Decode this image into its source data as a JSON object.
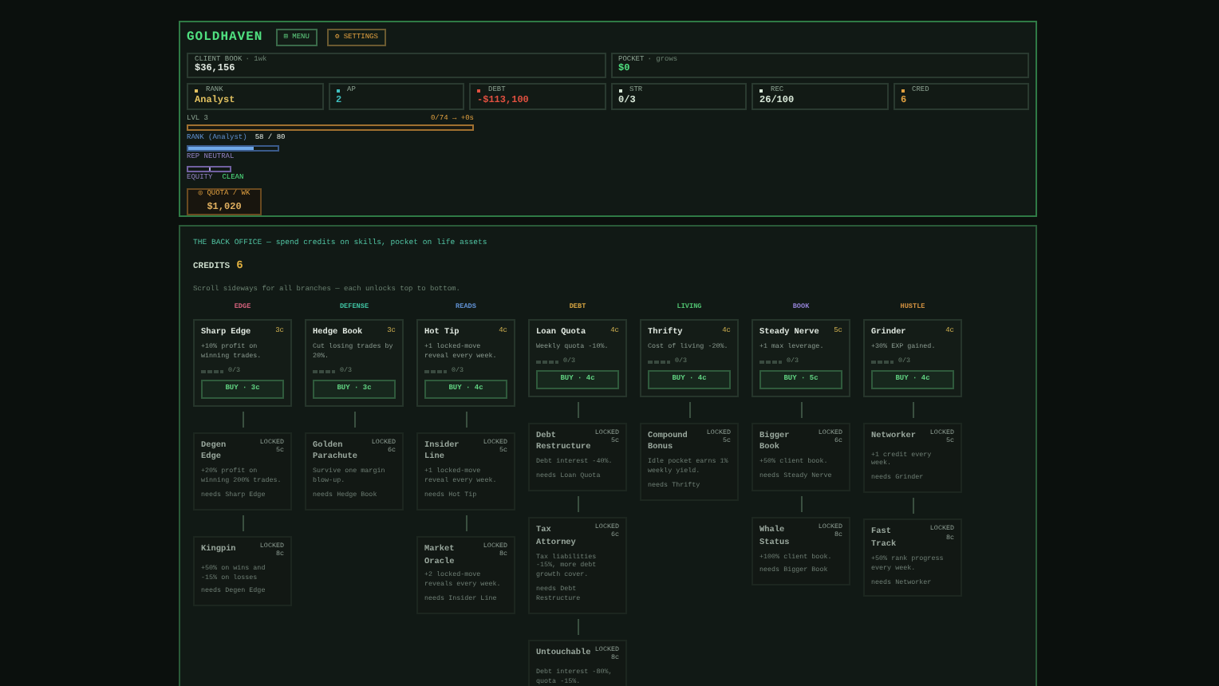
{
  "header": {
    "logo": "GOLDHAVEN",
    "buttons": [
      {
        "icon": "⊞",
        "label": "MENU",
        "kind": "menu"
      },
      {
        "icon": "⚙",
        "label": "SETTINGS",
        "kind": "settings"
      }
    ]
  },
  "wallets": [
    {
      "label": "CLIENT BOOK",
      "note": "· 1wk",
      "value": "$36,156",
      "kind": "book"
    },
    {
      "label": "POCKET",
      "note": "· grows",
      "value": "$0",
      "kind": "pocket"
    }
  ],
  "stats": [
    {
      "label": "RANK",
      "value": "Analyst",
      "color": "#e0c060"
    },
    {
      "label": "AP",
      "value": "2",
      "color": "#40c0c0"
    },
    {
      "label": "DEBT",
      "value": "-$113,100",
      "color": "#e05040"
    },
    {
      "label": "STR",
      "value": "0/3",
      "color": "#d8e8d8"
    },
    {
      "label": "REC",
      "value": "26/100",
      "color": "#d8e8d8"
    },
    {
      "label": "CRED",
      "value": "6",
      "color": "#e0a040"
    }
  ],
  "level": {
    "label": "LVL 3",
    "reading": "0/74 → +0s",
    "level": 0
  },
  "rank": {
    "label": "RANK (Analyst)",
    "reading": "58 / 80",
    "level": 0.73
  },
  "rep": {
    "label": "REP NEUTRAL",
    "level": 0.5
  },
  "equity": {
    "label": "EQUITY",
    "value": "CLEAN"
  },
  "quota": {
    "icon": "◎",
    "label": "QUOTA / WK",
    "value": "$1,020"
  },
  "office": {
    "title": "THE BACK OFFICE — spend credits on skills, pocket on life assets",
    "credits_label": "CREDITS",
    "credits": "6",
    "hint": "Scroll sideways for all branches — each unlocks top to bottom."
  },
  "branches": [
    {
      "name": "EDGE",
      "color": "#d0607a",
      "skills": [
        {
          "kind": "active",
          "name": "Sharp Edge",
          "cost": "3c",
          "desc": "+10% profit on winning trades.",
          "progress": "0/3",
          "level": 0,
          "button": "BUY · 3c"
        },
        {
          "kind": "locked",
          "name": "Degen Edge",
          "lock": "LOCKED 5c",
          "desc": "+20% profit on winning 200% trades.",
          "needs": "needs Sharp Edge"
        },
        {
          "kind": "locked",
          "name": "Kingpin",
          "lock": "LOCKED 8c",
          "desc": "+50% on wins and -15% on losses",
          "needs": "needs Degen Edge"
        }
      ]
    },
    {
      "name": "DEFENSE",
      "color": "#3fbf9f",
      "skills": [
        {
          "kind": "active",
          "name": "Hedge Book",
          "cost": "3c",
          "desc": "Cut losing trades by 20%.",
          "progress": "0/3",
          "level": 0,
          "button": "BUY · 3c"
        },
        {
          "kind": "locked",
          "name": "Golden Parachute",
          "lock": "LOCKED 6c",
          "desc": "Survive one margin blow-up.",
          "needs": "needs Hedge Book"
        }
      ]
    },
    {
      "name": "READS",
      "color": "#5f8fd0",
      "skills": [
        {
          "kind": "active",
          "name": "Hot Tip",
          "cost": "4c",
          "desc": "+1 locked-move reveal every week.",
          "progress": "0/3",
          "level": 0,
          "button": "BUY · 4c"
        },
        {
          "kind": "locked",
          "name": "Insider Line",
          "lock": "LOCKED 5c",
          "desc": "+1 locked-move reveal every week.",
          "needs": "needs Hot Tip"
        },
        {
          "kind": "locked",
          "name": "Market Oracle",
          "lock": "LOCKED 8c",
          "desc": "+2 locked-move reveals every week.",
          "needs": "needs Insider Line"
        }
      ]
    },
    {
      "name": "DEBT",
      "color": "#d0a040",
      "skills": [
        {
          "kind": "active",
          "name": "Loan Quota",
          "cost": "4c",
          "desc": "Weekly quota -10%.",
          "progress": "0/3",
          "level": 0,
          "button": "BUY · 4c"
        },
        {
          "kind": "locked",
          "name": "Debt Restructure",
          "lock": "LOCKED 5c",
          "desc": "Debt interest -40%.",
          "needs": "needs Loan Quota"
        },
        {
          "kind": "locked",
          "name": "Tax Attorney",
          "lock": "LOCKED 6c",
          "desc": "Tax liabilities -15%, more debt growth cover.",
          "needs": "needs Debt Restructure"
        },
        {
          "kind": "locked",
          "name": "Untouchable",
          "lock": "LOCKED 8c",
          "desc": "Debt interest -80%, quota -15%."
        }
      ]
    },
    {
      "name": "LIVING",
      "color": "#4fbf6f",
      "skills": [
        {
          "kind": "active",
          "name": "Thrifty",
          "cost": "4c",
          "desc": "Cost of living -20%.",
          "progress": "0/3",
          "level": 0,
          "button": "BUY · 4c"
        },
        {
          "kind": "locked",
          "name": "Compound Bonus",
          "lock": "LOCKED 5c",
          "desc": "Idle pocket earns 1% weekly yield.",
          "needs": "needs Thrifty"
        }
      ]
    },
    {
      "name": "BOOK",
      "color": "#8f7fd0",
      "skills": [
        {
          "kind": "active",
          "name": "Steady Nerve",
          "cost": "5c",
          "desc": "+1 max leverage.",
          "progress": "0/3",
          "level": 0,
          "button": "BUY · 5c"
        },
        {
          "kind": "locked",
          "name": "Bigger Book",
          "lock": "LOCKED 6c",
          "desc": "+50% client book.",
          "needs": "needs Steady Nerve"
        },
        {
          "kind": "locked",
          "name": "Whale Status",
          "lock": "LOCKED 8c",
          "desc": "+100% client book.",
          "needs": "needs Bigger Book"
        }
      ]
    },
    {
      "name": "HUSTLE",
      "color": "#d09040",
      "skills": [
        {
          "kind": "active",
          "name": "Grinder",
          "cost": "4c",
          "desc": "+30% EXP gained.",
          "progress": "0/3",
          "level": 0,
          "button": "BUY · 4c"
        },
        {
          "kind": "locked",
          "name": "Networker",
          "lock": "LOCKED 5c",
          "desc": "+1 credit every week.",
          "needs": "needs Grinder"
        },
        {
          "kind": "locked",
          "name": "Fast Track",
          "lock": "LOCKED 8c",
          "desc": "+50% rank progress every week.",
          "needs": "needs Networker"
        }
      ]
    }
  ]
}
